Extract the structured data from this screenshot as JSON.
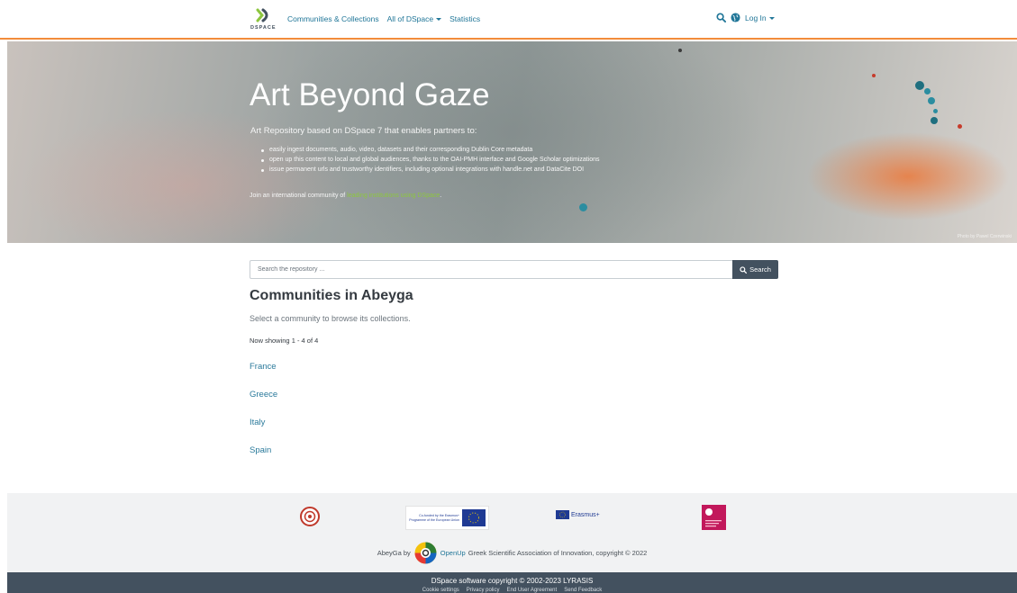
{
  "header": {
    "logo_text": "DSPACE",
    "nav": {
      "communities": "Communities & Collections",
      "all_of_dspace": "All of DSpace",
      "statistics": "Statistics"
    },
    "login": "Log In"
  },
  "banner": {
    "title": "Art Beyond Gaze",
    "subtitle": "Art Repository based on DSpace 7 that enables partners to:",
    "bullets": [
      "easily ingest documents, audio, video, datasets and their corresponding Dublin Core metadata",
      "open up this content to local and global audiences, thanks to the OAI-PMH interface and Google Scholar optimizations",
      "issue permanent urls and trustworthy identifiers, including optional integrations with handle.net and DataCite DOI"
    ],
    "join_prefix": "Join an international community of ",
    "join_link": "leading institutions using DSpace",
    "join_suffix": ".",
    "photo_credit": "Photo by Pawel Czerwinski"
  },
  "search": {
    "placeholder": "Search the repository ...",
    "button_label": "Search"
  },
  "communities": {
    "title": "Communities in Abeyga",
    "description": "Select a community to browse its collections.",
    "showing": "Now showing 1 - 4 of 4",
    "items": [
      "France",
      "Greece",
      "Italy",
      "Spain"
    ]
  },
  "footer": {
    "eu_logo_text": "Co-funded by the Erasmus+ Programme of the European Union",
    "erasmus_text": "Erasmus+",
    "credit_prefix": "AbeyGa by",
    "openup_link": "OpenUp",
    "credit_suffix": "Greek Scientific Association of Innovation, copyright © 2022",
    "copyright": "DSpace software copyright © 2002-2023 LYRASIS",
    "links": [
      "Cookie settings",
      "Privacy policy",
      "End User Agreement",
      "Send Feedback"
    ]
  },
  "colors": {
    "accent_orange": "#f28c3b",
    "link_blue": "#207698",
    "dark_slate": "#43515f",
    "dspace_green": "#8dc63f"
  }
}
